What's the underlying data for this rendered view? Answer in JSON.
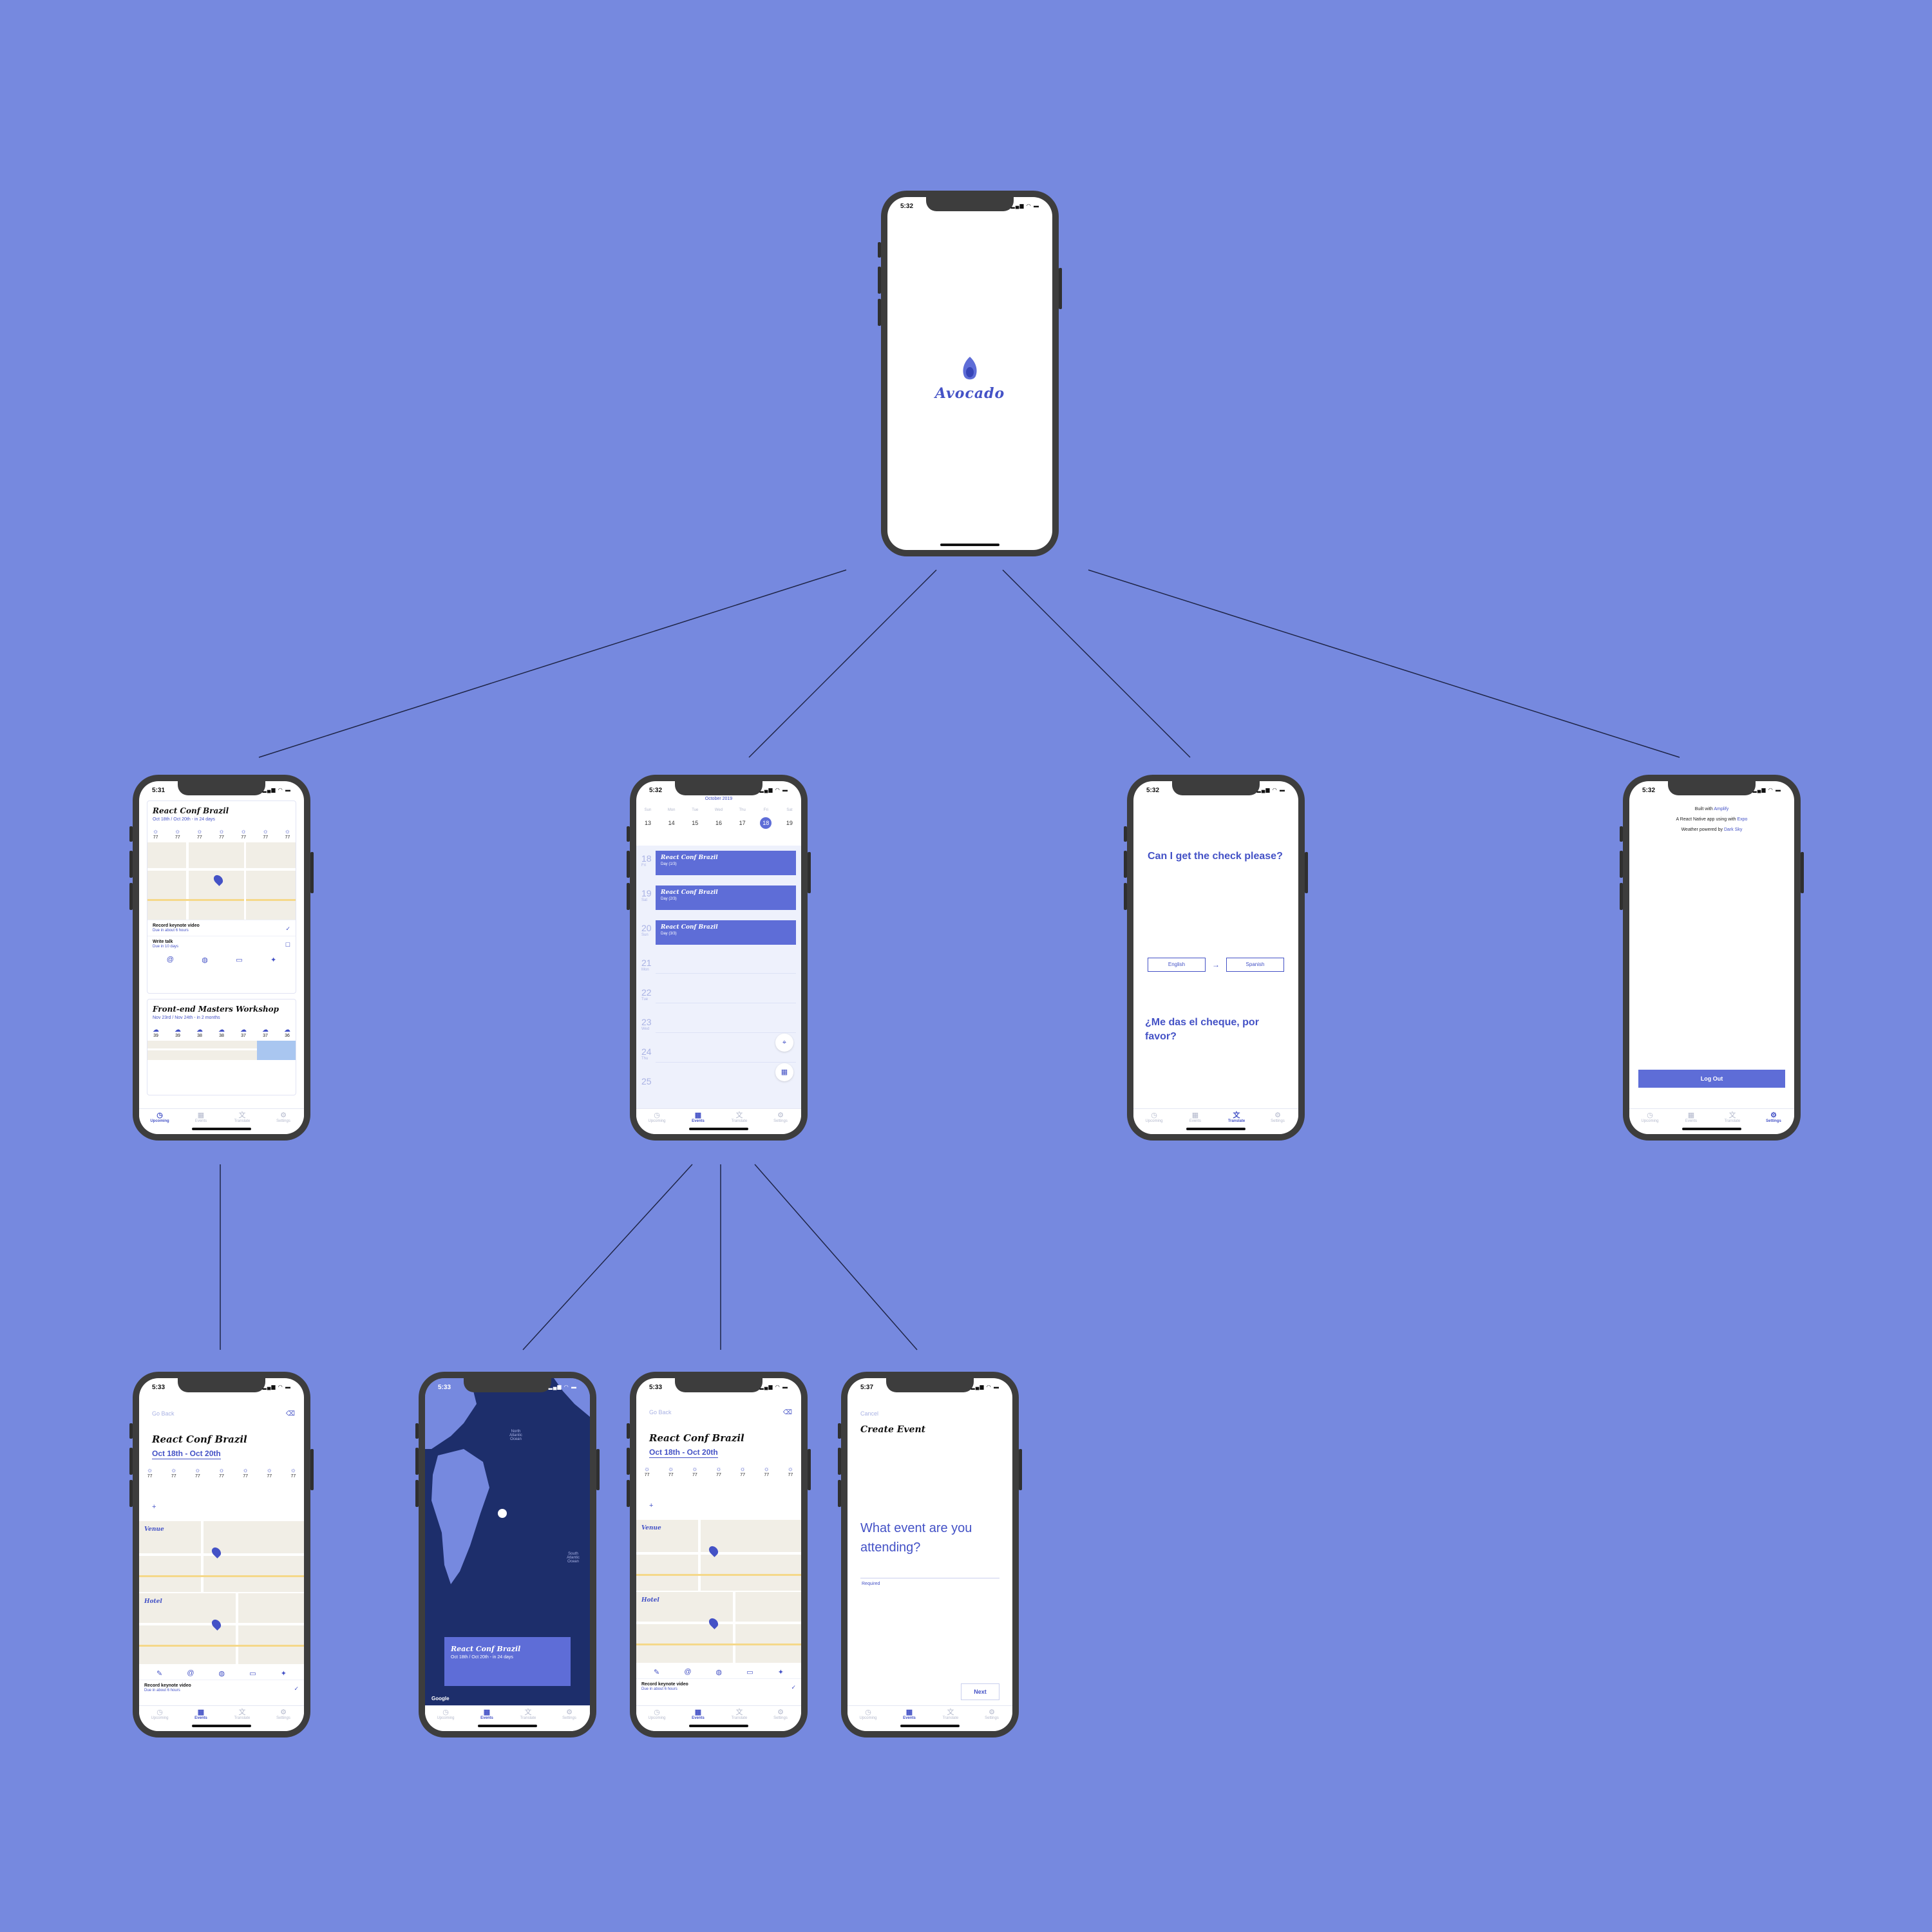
{
  "screens": {
    "splash": {
      "time": "5:32",
      "logo_text": "Avocado"
    },
    "upcoming": {
      "time": "5:31",
      "card1": {
        "title": "React Conf Brazil",
        "subtitle": "Oct 18th / Oct 20th - in 24 days",
        "temps": [
          "77",
          "77",
          "77",
          "77",
          "77",
          "77",
          "77"
        ],
        "todos": [
          {
            "title": "Record keynote video",
            "due": "Due in about 6 hours"
          },
          {
            "title": "Write talk",
            "due": "Due in 10 days"
          }
        ]
      },
      "card2": {
        "title": "Front-end Masters Workshop",
        "subtitle": "Nov 23rd / Nov 24th - in 2 months",
        "temps": [
          "39",
          "39",
          "38",
          "38",
          "37",
          "37",
          "36"
        ]
      }
    },
    "events": {
      "time": "5:32",
      "month": "October 2019",
      "weekdays": [
        "Sun",
        "Mon",
        "Tue",
        "Wed",
        "Thu",
        "Fri",
        "Sat"
      ],
      "dates": [
        "13",
        "14",
        "15",
        "16",
        "17",
        "18",
        "19"
      ],
      "rows": [
        {
          "day": "18",
          "dow": "Fri",
          "event": "React Conf Brazil",
          "sub": "Day (1/3)"
        },
        {
          "day": "19",
          "dow": "Sat",
          "event": "React Conf Brazil",
          "sub": "Day (2/3)"
        },
        {
          "day": "20",
          "dow": "Sun",
          "event": "React Conf Brazil",
          "sub": "Day (3/3)"
        },
        {
          "day": "21",
          "dow": "Mon"
        },
        {
          "day": "22",
          "dow": "Tue"
        },
        {
          "day": "23",
          "dow": "Wed"
        },
        {
          "day": "24",
          "dow": "Thu"
        },
        {
          "day": "25",
          "dow": ""
        }
      ]
    },
    "translate": {
      "time": "5:32",
      "source_text": "Can I get the check please?",
      "from_lang": "English",
      "to_lang": "Spanish",
      "translated_text": "¿Me das el cheque, por favor?"
    },
    "settings": {
      "time": "5:32",
      "line1_prefix": "Built with",
      "line1_link": "Amplify",
      "line2_prefix": "A React Native app using with",
      "line2_link": "Expo",
      "line3_prefix": "Weather powered by",
      "line3_link": "Dark Sky",
      "logout_label": "Log Out"
    },
    "detail": {
      "time": "5:33",
      "go_back": "Go Back",
      "title": "React Conf Brazil",
      "dates": "Oct 18th - Oct 20th",
      "temps": [
        "77",
        "77",
        "77",
        "77",
        "77",
        "77",
        "77"
      ],
      "venue_label": "Venue",
      "hotel_label": "Hotel",
      "todo_title": "Record keynote video",
      "todo_due": "Due in about 6 hours"
    },
    "map": {
      "time": "5:33",
      "card_title": "React Conf Brazil",
      "card_sub": "Oct 18th / Oct 20th - in 24 days",
      "ocean1": "North Atlantic Ocean",
      "ocean2": "South Atlantic Ocean",
      "attribution": "Google"
    },
    "detail2": {
      "time": "5:33",
      "go_back": "Go Back",
      "title": "React Conf Brazil",
      "dates": "Oct 18th - Oct 20th",
      "temps": [
        "77",
        "77",
        "77",
        "77",
        "77",
        "77",
        "77"
      ],
      "venue_label": "Venue",
      "hotel_label": "Hotel",
      "todo_title": "Record keynote video",
      "todo_due": "Due in about 6 hours"
    },
    "create": {
      "time": "5:37",
      "cancel": "Cancel",
      "title": "Create Event",
      "question": "What event are you attending?",
      "required": "Required",
      "next": "Next"
    }
  },
  "tabs": [
    "Upcoming",
    "Events",
    "Translate",
    "Settings"
  ],
  "colors": {
    "background": "#7689df",
    "accent": "#4452c6",
    "accent_light": "#5e6dd7"
  }
}
